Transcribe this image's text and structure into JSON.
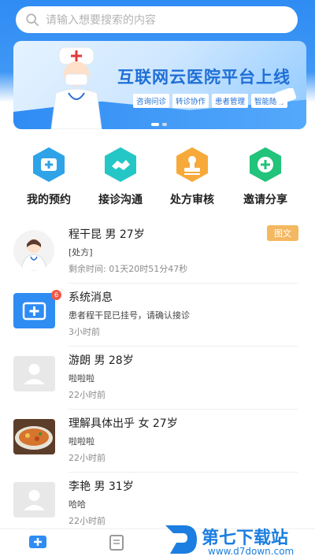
{
  "search": {
    "placeholder": "请输入想要搜索的内容"
  },
  "banner": {
    "title": "互联网云医院平台上线",
    "tags": [
      "咨询问诊",
      "转诊协作",
      "患者管理",
      "智能随访"
    ]
  },
  "menu": [
    {
      "label": "我的预约",
      "icon": "medical-kit-icon",
      "color": "#2fa3e8"
    },
    {
      "label": "接诊沟通",
      "icon": "handshake-icon",
      "color": "#25c6c6"
    },
    {
      "label": "处方审核",
      "icon": "stamp-icon",
      "color": "#f7a93a"
    },
    {
      "label": "邀请分享",
      "icon": "plus-icon",
      "color": "#22c37a"
    }
  ],
  "messages": [
    {
      "name": "程干昆 男 27岁",
      "line2": "[处方]",
      "line3": "剩余时间: 01天20时51分47秒",
      "tag": "图文",
      "avatar": "doctor-avatar"
    },
    {
      "name": "系统消息",
      "line2": "患者程干昆已挂号，请确认接诊",
      "line3": "3小时前",
      "badge": "6",
      "avatar": "system-message-icon"
    },
    {
      "name": "游朗 男 28岁",
      "line2": "啦啦啦",
      "line3": "22小时前",
      "avatar": "default-avatar"
    },
    {
      "name": "理解具体出乎 女 27岁",
      "line2": "啦啦啦",
      "line3": "22小时前",
      "avatar": "food-photo-avatar"
    },
    {
      "name": "李艳 男 31岁",
      "line2": "哈哈",
      "line3": "22小时前",
      "avatar": "default-avatar"
    }
  ],
  "watermark": {
    "main": "第七下载站",
    "sub": "www.d7down.com"
  },
  "colors": {
    "primary": "#2f8cf3",
    "tag": "#f4b860",
    "badge": "#f05a4a"
  }
}
